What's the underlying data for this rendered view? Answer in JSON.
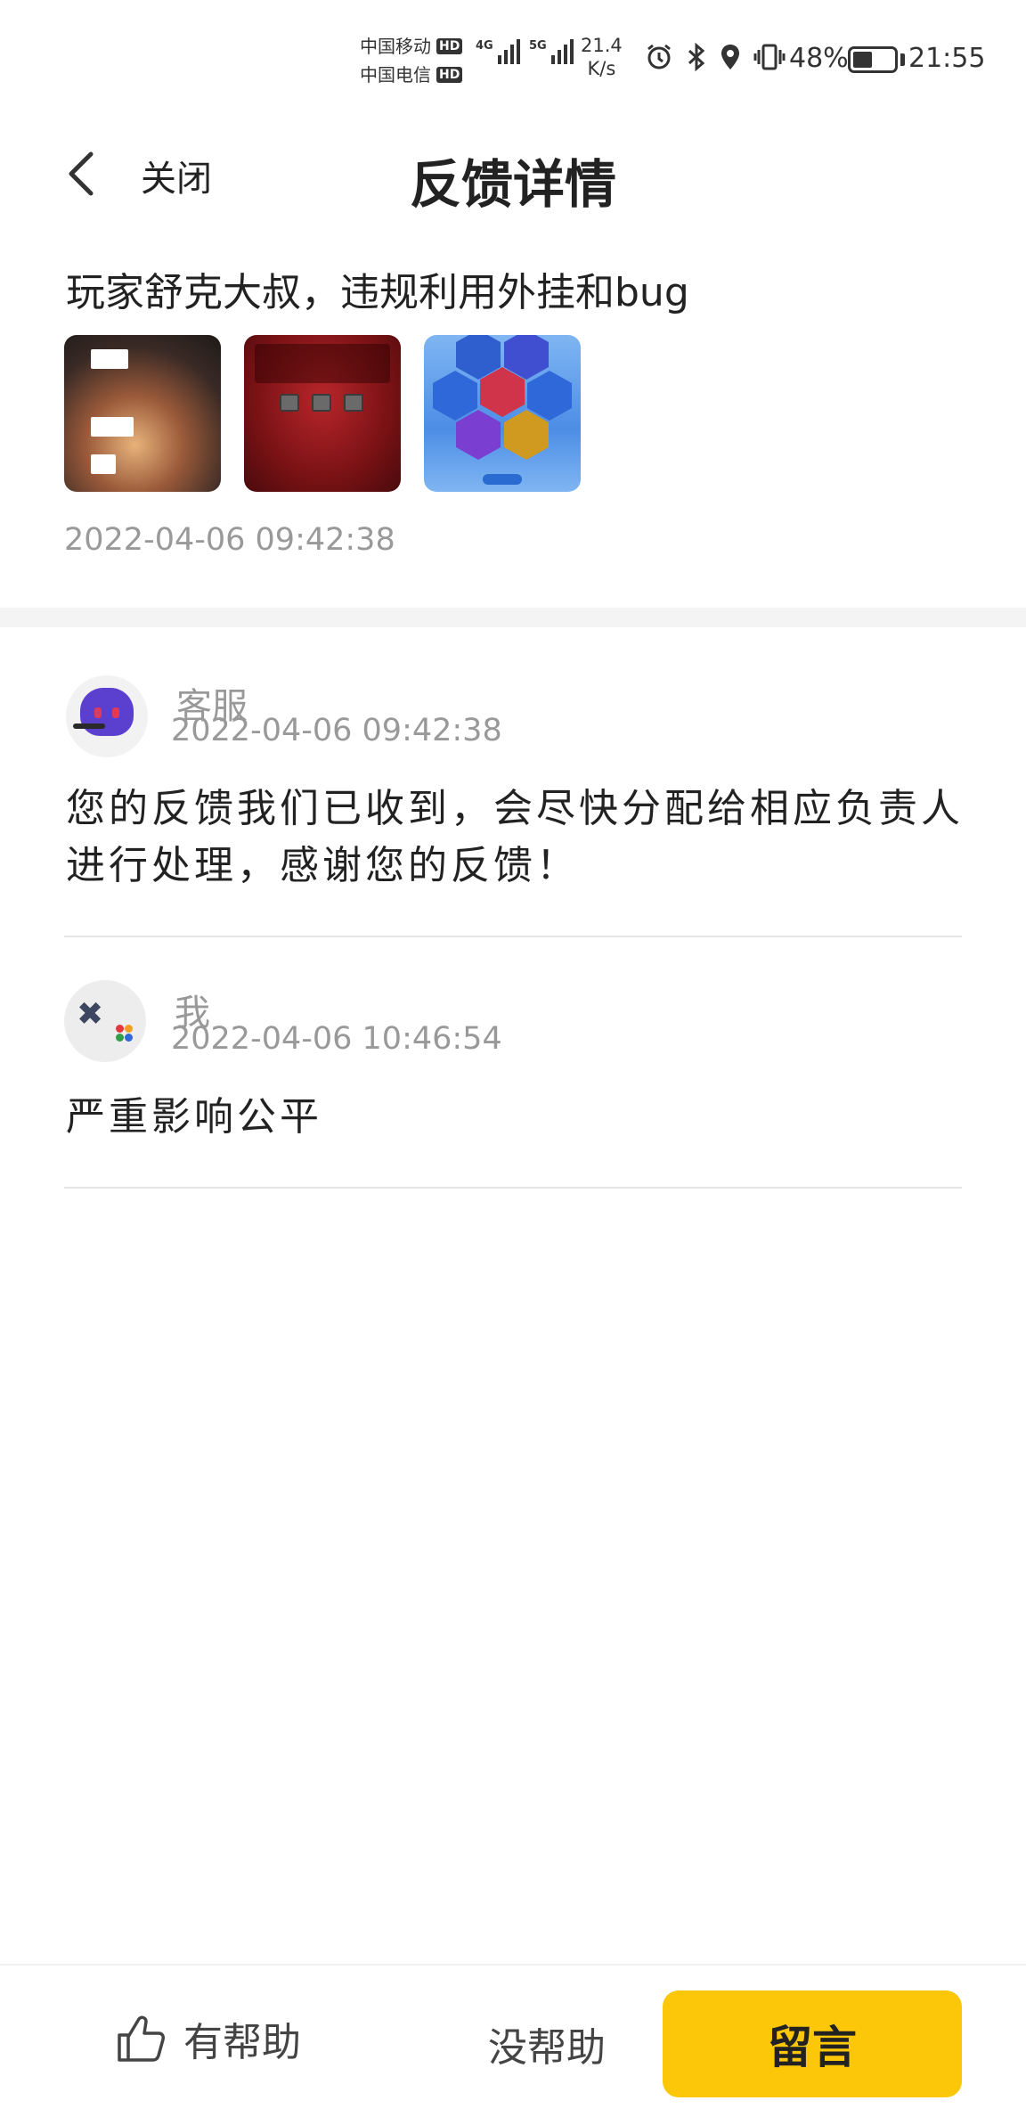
{
  "status_bar": {
    "carrier1": "中国移动",
    "carrier2": "中国电信",
    "hd_badge": "HD",
    "net1": "4G",
    "net2": "5G",
    "speed_value": "21.4",
    "speed_unit": "K/s",
    "battery_percent": "48%",
    "battery_level": 0.48,
    "time": "21:55",
    "icons": [
      "alarm-icon",
      "bluetooth-icon",
      "location-icon",
      "vibrate-icon"
    ]
  },
  "header": {
    "back_icon": "chevron-left-icon",
    "close_label": "关闭",
    "title": "反馈详情"
  },
  "feedback": {
    "text": "玩家舒克大叔，违规利用外挂和bug",
    "thumbnails": [
      "screenshot-chat",
      "screenshot-reward",
      "screenshot-hex-menu"
    ],
    "timestamp": "2022-04-06  09:42:38"
  },
  "messages": [
    {
      "sender": "客服",
      "time": "2022-04-06  09:42:38",
      "body": "您的反馈我们已收到，会尽快分配给相应负责人进行处理，感谢您的反馈！"
    },
    {
      "sender": "我",
      "time": "2022-04-06  10:46:54",
      "body": "严重影响公平"
    }
  ],
  "bottom_bar": {
    "helpful_label": "有帮助",
    "unhelpful_label": "没帮助",
    "comment_label": "留言"
  },
  "colors": {
    "accent": "#fcc708",
    "muted_text": "#999999",
    "text": "#222222"
  }
}
